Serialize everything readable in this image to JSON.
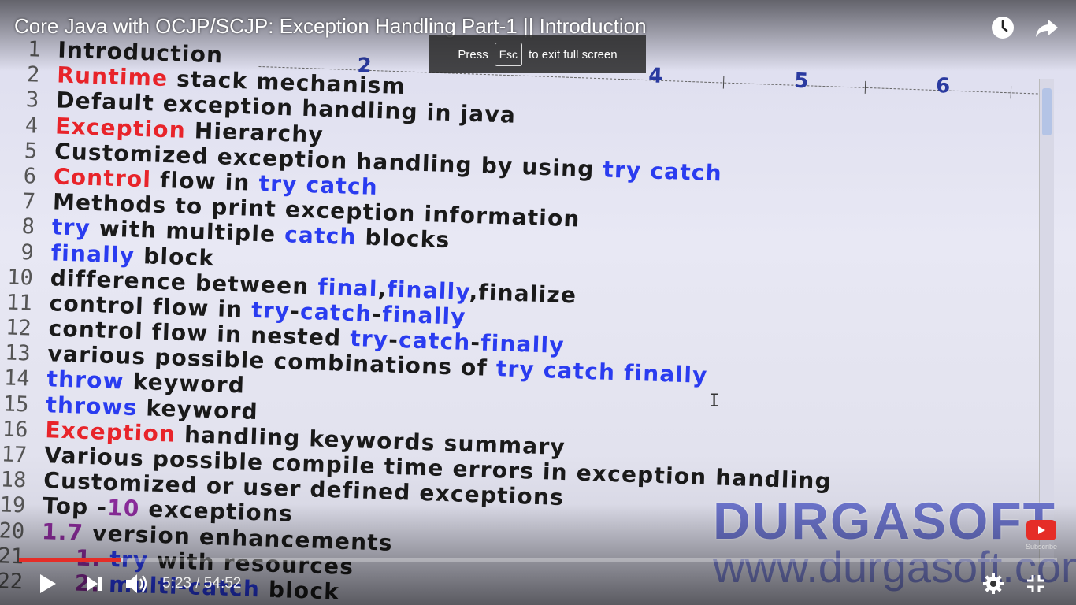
{
  "player": {
    "title": "Core Java with OCJP/SCJP: Exception Handling Part-1 || Introduction",
    "fullscreen_notice": {
      "press": "Press",
      "key": "Esc",
      "rest": "to exit full screen"
    },
    "time_current": "5:23",
    "time_separator": "/",
    "time_total": "54:52",
    "progress_played": 0.098,
    "progress_loaded": 0.1,
    "subscribe_label": "Subscribe",
    "accent_color": "#e52d27"
  },
  "ruler": {
    "numbers": [
      "2",
      "4",
      "5",
      "6"
    ]
  },
  "editor": {
    "lines": [
      {
        "n": "1",
        "parts": [
          {
            "t": "Introduction",
            "c": ""
          }
        ]
      },
      {
        "n": "2",
        "parts": [
          {
            "t": "Runtime",
            "c": "red"
          },
          {
            "t": " stack mechanism",
            "c": ""
          }
        ]
      },
      {
        "n": "3",
        "parts": [
          {
            "t": "Default exception handling in java",
            "c": ""
          }
        ]
      },
      {
        "n": "4",
        "parts": [
          {
            "t": "Exception",
            "c": "red"
          },
          {
            "t": " Hierarchy",
            "c": ""
          }
        ]
      },
      {
        "n": "5",
        "parts": [
          {
            "t": "Customized exception handling by using ",
            "c": ""
          },
          {
            "t": "try catch",
            "c": "blue"
          }
        ]
      },
      {
        "n": "6",
        "parts": [
          {
            "t": "Control",
            "c": "red"
          },
          {
            "t": " flow in ",
            "c": ""
          },
          {
            "t": "try catch",
            "c": "blue"
          }
        ]
      },
      {
        "n": "7",
        "parts": [
          {
            "t": "Methods to print exception information",
            "c": ""
          }
        ]
      },
      {
        "n": "8",
        "parts": [
          {
            "t": "try",
            "c": "blue"
          },
          {
            "t": " with multiple ",
            "c": ""
          },
          {
            "t": "catch",
            "c": "blue"
          },
          {
            "t": " blocks",
            "c": ""
          }
        ]
      },
      {
        "n": "9",
        "parts": [
          {
            "t": "finally",
            "c": "blue"
          },
          {
            "t": " block",
            "c": ""
          }
        ]
      },
      {
        "n": "10",
        "parts": [
          {
            "t": "difference between ",
            "c": ""
          },
          {
            "t": "final",
            "c": "blue"
          },
          {
            "t": ",",
            "c": ""
          },
          {
            "t": "finally",
            "c": "blue"
          },
          {
            "t": ",finalize",
            "c": ""
          }
        ]
      },
      {
        "n": "11",
        "parts": [
          {
            "t": "control flow in ",
            "c": ""
          },
          {
            "t": "try",
            "c": "blue"
          },
          {
            "t": "-",
            "c": ""
          },
          {
            "t": "catch",
            "c": "blue"
          },
          {
            "t": "-",
            "c": ""
          },
          {
            "t": "finally",
            "c": "blue"
          }
        ]
      },
      {
        "n": "12",
        "parts": [
          {
            "t": "control flow in nested ",
            "c": ""
          },
          {
            "t": "try",
            "c": "blue"
          },
          {
            "t": "-",
            "c": ""
          },
          {
            "t": "catch",
            "c": "blue"
          },
          {
            "t": "-",
            "c": ""
          },
          {
            "t": "finally",
            "c": "blue"
          }
        ]
      },
      {
        "n": "13",
        "parts": [
          {
            "t": "various possible combinations of ",
            "c": ""
          },
          {
            "t": "try catch finally",
            "c": "blue"
          }
        ]
      },
      {
        "n": "14",
        "parts": [
          {
            "t": "throw",
            "c": "blue"
          },
          {
            "t": " keyword",
            "c": ""
          }
        ]
      },
      {
        "n": "15",
        "parts": [
          {
            "t": "throws",
            "c": "blue"
          },
          {
            "t": " keyword",
            "c": ""
          }
        ]
      },
      {
        "n": "16",
        "parts": [
          {
            "t": "Exception",
            "c": "red"
          },
          {
            "t": " handling keywords summary",
            "c": ""
          }
        ]
      },
      {
        "n": "17",
        "parts": [
          {
            "t": "Various possible compile time errors in exception handling",
            "c": ""
          }
        ]
      },
      {
        "n": "18",
        "parts": [
          {
            "t": "Customized or user defined exceptions",
            "c": ""
          }
        ]
      },
      {
        "n": "19",
        "parts": [
          {
            "t": "Top -",
            "c": ""
          },
          {
            "t": "10",
            "c": "purple"
          },
          {
            "t": " exceptions",
            "c": ""
          }
        ]
      },
      {
        "n": "20",
        "parts": [
          {
            "t": "1.7",
            "c": "purple"
          },
          {
            "t": " version enhancements",
            "c": ""
          }
        ]
      },
      {
        "n": "21",
        "parts": [
          {
            "t": "    1. ",
            "c": "purple"
          },
          {
            "t": "try",
            "c": "blue"
          },
          {
            "t": " with resources",
            "c": ""
          }
        ]
      },
      {
        "n": "22",
        "parts": [
          {
            "t": "    2. ",
            "c": "purple"
          },
          {
            "t": "multi-catch",
            "c": "blue"
          },
          {
            "t": " block",
            "c": ""
          }
        ]
      }
    ]
  },
  "watermark": {
    "brand": "DURGASOFT",
    "site": "www.durgasoft.com"
  }
}
